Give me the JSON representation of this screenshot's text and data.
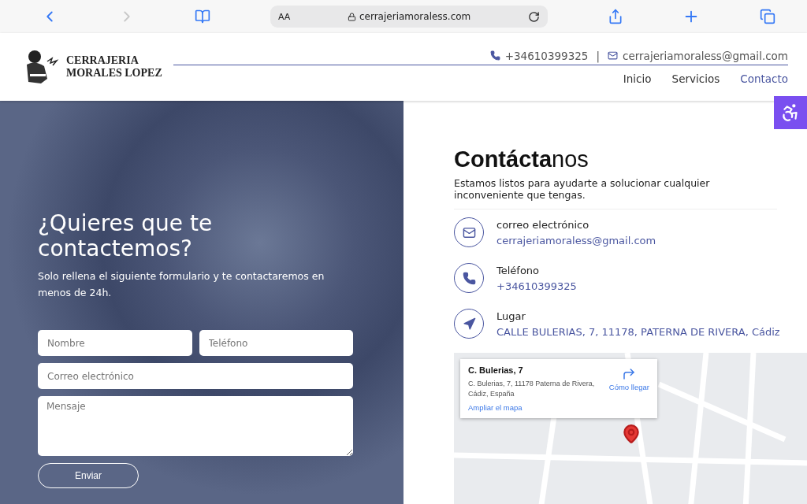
{
  "browser": {
    "text_size": "AA",
    "url": "cerrajeriamoraless.com"
  },
  "header": {
    "logo_lines": [
      "CERRAJERIA",
      "MORALES LOPEZ"
    ],
    "phone": "+34610399325",
    "separator": "|",
    "email": "cerrajeriamoraless@gmail.com",
    "nav": [
      {
        "label": "Inicio",
        "selected": false
      },
      {
        "label": "Servicios",
        "selected": false
      },
      {
        "label": "Contacto",
        "selected": true
      }
    ]
  },
  "form": {
    "title": "¿Quieres que te contactemos?",
    "subtitle": "Solo rellena el siguiente formulario y te contactaremos en menos de 24h.",
    "fields": [
      {
        "placeholder": "Nombre",
        "kind": "half"
      },
      {
        "placeholder": "Teléfono",
        "kind": "half"
      },
      {
        "placeholder": "Correo electrónico",
        "kind": "full"
      },
      {
        "placeholder": "Mensaje",
        "kind": "area"
      }
    ],
    "submit": "Enviar"
  },
  "contact": {
    "title": "**Contácta**nos",
    "intro": "Estamos listos para ayudarte a solucionar cualquier inconveniente que tengas.",
    "items": [
      {
        "kind": "mail",
        "label": "correo electrónico",
        "value": "cerrajeriamoraless@gmail.com"
      },
      {
        "kind": "phone",
        "label": "Teléfono",
        "value": "+34610399325"
      },
      {
        "kind": "place",
        "label": "Lugar",
        "value": "CALLE BULERIAS, 7, 11178, PATERNA DE RIVERA, Cádiz"
      }
    ]
  },
  "map": {
    "place_title": "C. Bulerias, 7",
    "address": "C. Bulerias, 7, 11178 Paterna de Rivera, Cádiz, España",
    "directions": "Cómo llegar",
    "enlarge": "Ampliar el mapa"
  }
}
